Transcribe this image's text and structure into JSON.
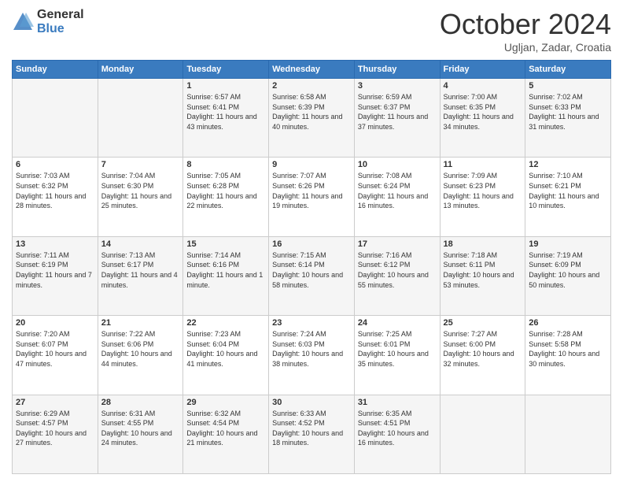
{
  "logo": {
    "general": "General",
    "blue": "Blue"
  },
  "header": {
    "month": "October 2024",
    "location": "Ugljan, Zadar, Croatia"
  },
  "weekdays": [
    "Sunday",
    "Monday",
    "Tuesday",
    "Wednesday",
    "Thursday",
    "Friday",
    "Saturday"
  ],
  "weeks": [
    [
      {
        "day": null,
        "info": null
      },
      {
        "day": null,
        "info": null
      },
      {
        "day": "1",
        "info": "Sunrise: 6:57 AM\nSunset: 6:41 PM\nDaylight: 11 hours and 43 minutes."
      },
      {
        "day": "2",
        "info": "Sunrise: 6:58 AM\nSunset: 6:39 PM\nDaylight: 11 hours and 40 minutes."
      },
      {
        "day": "3",
        "info": "Sunrise: 6:59 AM\nSunset: 6:37 PM\nDaylight: 11 hours and 37 minutes."
      },
      {
        "day": "4",
        "info": "Sunrise: 7:00 AM\nSunset: 6:35 PM\nDaylight: 11 hours and 34 minutes."
      },
      {
        "day": "5",
        "info": "Sunrise: 7:02 AM\nSunset: 6:33 PM\nDaylight: 11 hours and 31 minutes."
      }
    ],
    [
      {
        "day": "6",
        "info": "Sunrise: 7:03 AM\nSunset: 6:32 PM\nDaylight: 11 hours and 28 minutes."
      },
      {
        "day": "7",
        "info": "Sunrise: 7:04 AM\nSunset: 6:30 PM\nDaylight: 11 hours and 25 minutes."
      },
      {
        "day": "8",
        "info": "Sunrise: 7:05 AM\nSunset: 6:28 PM\nDaylight: 11 hours and 22 minutes."
      },
      {
        "day": "9",
        "info": "Sunrise: 7:07 AM\nSunset: 6:26 PM\nDaylight: 11 hours and 19 minutes."
      },
      {
        "day": "10",
        "info": "Sunrise: 7:08 AM\nSunset: 6:24 PM\nDaylight: 11 hours and 16 minutes."
      },
      {
        "day": "11",
        "info": "Sunrise: 7:09 AM\nSunset: 6:23 PM\nDaylight: 11 hours and 13 minutes."
      },
      {
        "day": "12",
        "info": "Sunrise: 7:10 AM\nSunset: 6:21 PM\nDaylight: 11 hours and 10 minutes."
      }
    ],
    [
      {
        "day": "13",
        "info": "Sunrise: 7:11 AM\nSunset: 6:19 PM\nDaylight: 11 hours and 7 minutes."
      },
      {
        "day": "14",
        "info": "Sunrise: 7:13 AM\nSunset: 6:17 PM\nDaylight: 11 hours and 4 minutes."
      },
      {
        "day": "15",
        "info": "Sunrise: 7:14 AM\nSunset: 6:16 PM\nDaylight: 11 hours and 1 minute."
      },
      {
        "day": "16",
        "info": "Sunrise: 7:15 AM\nSunset: 6:14 PM\nDaylight: 10 hours and 58 minutes."
      },
      {
        "day": "17",
        "info": "Sunrise: 7:16 AM\nSunset: 6:12 PM\nDaylight: 10 hours and 55 minutes."
      },
      {
        "day": "18",
        "info": "Sunrise: 7:18 AM\nSunset: 6:11 PM\nDaylight: 10 hours and 53 minutes."
      },
      {
        "day": "19",
        "info": "Sunrise: 7:19 AM\nSunset: 6:09 PM\nDaylight: 10 hours and 50 minutes."
      }
    ],
    [
      {
        "day": "20",
        "info": "Sunrise: 7:20 AM\nSunset: 6:07 PM\nDaylight: 10 hours and 47 minutes."
      },
      {
        "day": "21",
        "info": "Sunrise: 7:22 AM\nSunset: 6:06 PM\nDaylight: 10 hours and 44 minutes."
      },
      {
        "day": "22",
        "info": "Sunrise: 7:23 AM\nSunset: 6:04 PM\nDaylight: 10 hours and 41 minutes."
      },
      {
        "day": "23",
        "info": "Sunrise: 7:24 AM\nSunset: 6:03 PM\nDaylight: 10 hours and 38 minutes."
      },
      {
        "day": "24",
        "info": "Sunrise: 7:25 AM\nSunset: 6:01 PM\nDaylight: 10 hours and 35 minutes."
      },
      {
        "day": "25",
        "info": "Sunrise: 7:27 AM\nSunset: 6:00 PM\nDaylight: 10 hours and 32 minutes."
      },
      {
        "day": "26",
        "info": "Sunrise: 7:28 AM\nSunset: 5:58 PM\nDaylight: 10 hours and 30 minutes."
      }
    ],
    [
      {
        "day": "27",
        "info": "Sunrise: 6:29 AM\nSunset: 4:57 PM\nDaylight: 10 hours and 27 minutes."
      },
      {
        "day": "28",
        "info": "Sunrise: 6:31 AM\nSunset: 4:55 PM\nDaylight: 10 hours and 24 minutes."
      },
      {
        "day": "29",
        "info": "Sunrise: 6:32 AM\nSunset: 4:54 PM\nDaylight: 10 hours and 21 minutes."
      },
      {
        "day": "30",
        "info": "Sunrise: 6:33 AM\nSunset: 4:52 PM\nDaylight: 10 hours and 18 minutes."
      },
      {
        "day": "31",
        "info": "Sunrise: 6:35 AM\nSunset: 4:51 PM\nDaylight: 10 hours and 16 minutes."
      },
      {
        "day": null,
        "info": null
      },
      {
        "day": null,
        "info": null
      }
    ]
  ]
}
